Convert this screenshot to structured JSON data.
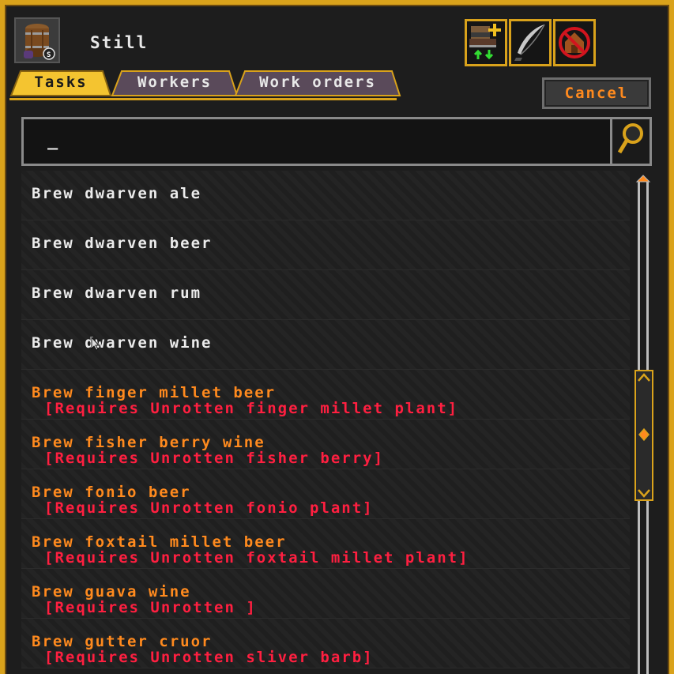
{
  "header": {
    "title": "Still",
    "icon": "barrel-icon"
  },
  "toolbar": {
    "icons": [
      "add-workshop-icon",
      "feather-quill-icon",
      "no-house-icon"
    ]
  },
  "tabs": [
    {
      "label": "Tasks",
      "active": true
    },
    {
      "label": "Workers",
      "active": false
    },
    {
      "label": "Work orders",
      "active": false
    }
  ],
  "cancel_label": "Cancel",
  "search": {
    "value": "",
    "caret": "_"
  },
  "tasks": [
    {
      "name": "Brew dwarven ale",
      "requirement": ""
    },
    {
      "name": "Brew dwarven beer",
      "requirement": ""
    },
    {
      "name": "Brew dwarven rum",
      "requirement": ""
    },
    {
      "name": "Brew dwarven wine",
      "requirement": ""
    },
    {
      "name": "Brew finger millet beer",
      "requirement": "[Requires Unrotten finger millet plant]"
    },
    {
      "name": "Brew fisher berry wine",
      "requirement": "[Requires Unrotten fisher berry]"
    },
    {
      "name": "Brew fonio beer",
      "requirement": "[Requires Unrotten fonio plant]"
    },
    {
      "name": "Brew foxtail millet beer",
      "requirement": "[Requires Unrotten foxtail millet plant]"
    },
    {
      "name": "Brew guava wine",
      "requirement": "[Requires Unrotten ]"
    },
    {
      "name": "Brew gutter cruor",
      "requirement": "[Requires Unrotten sliver barb]"
    }
  ],
  "colors": {
    "frame": "#d9a21b",
    "available_text": "#ececec",
    "unavailable_text": "#ff8a1e",
    "requirement_text": "#ff1f40"
  }
}
